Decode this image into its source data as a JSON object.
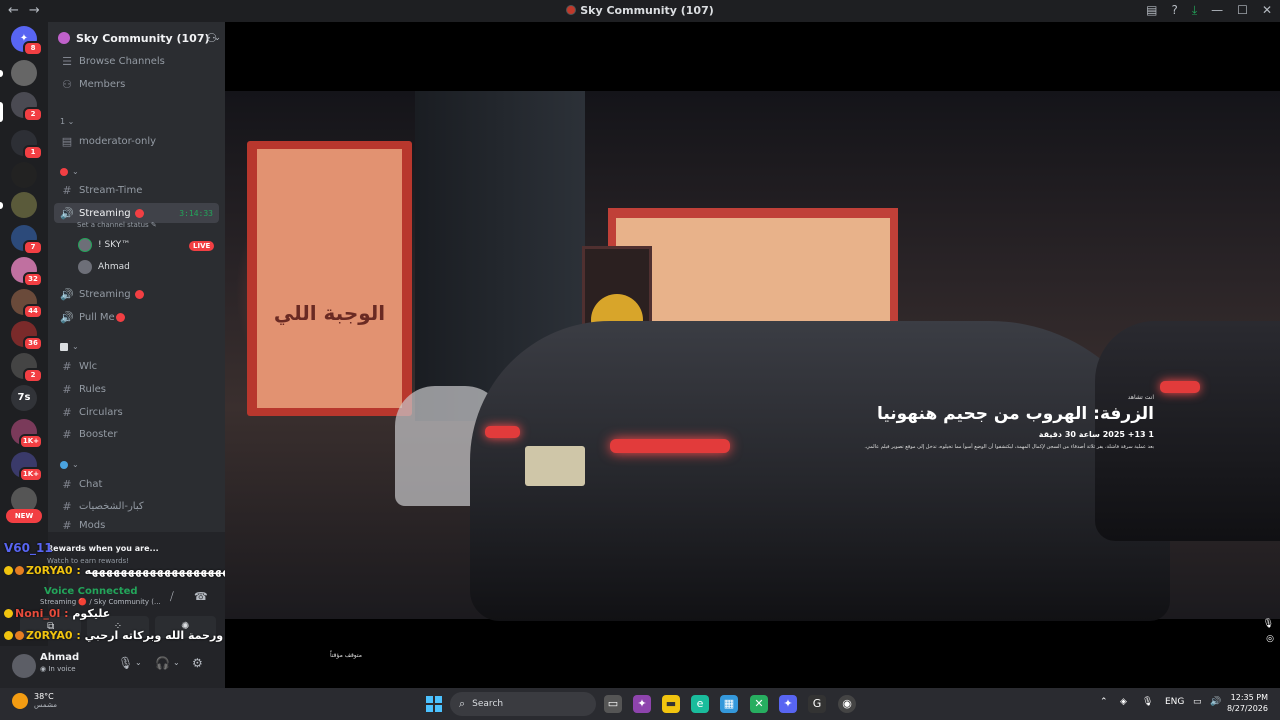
{
  "window": {
    "title": "Sky Community (107)"
  },
  "server": {
    "name": "Sky Community (107)"
  },
  "rail": {
    "badges": [
      "8",
      "2",
      "1",
      "7",
      "32",
      "44",
      "36",
      "2",
      "1K+",
      "1K+"
    ],
    "text_server": "7s",
    "new_label": "NEW"
  },
  "channels": {
    "browse": "Browse Channels",
    "members": "Members",
    "cat1": "1",
    "moderator": "moderator-only",
    "stream_time": "Stream-Time",
    "streaming": "Streaming",
    "streaming_time": "3:14:33",
    "set_status": "Set a channel status",
    "voice_user1": "! SKY™",
    "live": "LIVE",
    "voice_user2": "Ahmad",
    "streaming2": "Streaming",
    "pull_me": "Pull Me",
    "wlc": "Wlc",
    "rules": "Rules",
    "circulars": "Circulars",
    "booster": "Booster",
    "chat": "Chat",
    "personalities": "كبار-الشخصيات",
    "mods": "Mods"
  },
  "overlay_chat": {
    "vlabel": "V60_11",
    "line1_name": "Z0RYA0 :",
    "line1_text": "ههههههههههههههههههههههههههههههههههه",
    "line2_name": "Noni_0l :",
    "line2_text": "عليكوم",
    "line3_name": "Z0RYA0 :",
    "line3_text": "وعليكم السلام ورحمة الله وبركاته ارحبي"
  },
  "voice_panel": {
    "reward_title": "Rewards when you are...",
    "reward_sub": "Watch to earn rewards!",
    "connected": "Voice Connected",
    "sub": "Streaming 🔴 / Sky Community (..."
  },
  "user": {
    "name": "Ahmad",
    "status": "In voice"
  },
  "stream": {
    "kicker": "انت تشاهد",
    "title": "الزرفة: الهروب من جحيم هنهونيا",
    "meta": "1   13+   2025   ساعة 30 دقيقة",
    "desc": "بعد عملية سرقة فاشلة، يفر ثلاثة أصدقاء من السجن لإكمال المهمة، ليكتشفوا أن الوضع أسوأ مما تخيلوه، تدخل إلى موقع تصوير فيلم عالمي.",
    "sign_text": "الوجبة اللي",
    "stopped": "متوقف مؤقتاً"
  },
  "taskbar": {
    "temp": "38°C",
    "weather": "مشمس",
    "search": "Search",
    "lang": "ENG",
    "time": "12:35 PM",
    "date": "8/27/2026"
  },
  "colors": {
    "accent": "#5865f2",
    "live": "#f23f43",
    "online": "#23a55a"
  }
}
